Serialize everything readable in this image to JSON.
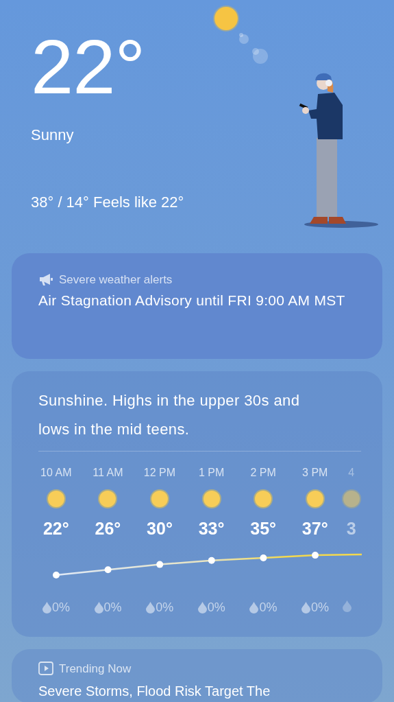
{
  "current": {
    "temperature": "22°",
    "condition": "Sunny",
    "range": "38° / 14° Feels like 22°"
  },
  "alert": {
    "header": "Severe weather alerts",
    "text": "Air Stagnation Advisory until FRI 9:00 AM MST"
  },
  "forecast": {
    "summary": "Sunshine. Highs in the upper 30s and lows in the mid teens.",
    "hours": [
      {
        "time": "10 AM",
        "temp": "22°",
        "precip": "0%"
      },
      {
        "time": "11 AM",
        "temp": "26°",
        "precip": "0%"
      },
      {
        "time": "12 PM",
        "temp": "30°",
        "precip": "0%"
      },
      {
        "time": "1 PM",
        "temp": "33°",
        "precip": "0%"
      },
      {
        "time": "2 PM",
        "temp": "35°",
        "precip": "0%"
      },
      {
        "time": "3 PM",
        "temp": "37°",
        "precip": "0%"
      },
      {
        "time": "4",
        "temp": "3"
      }
    ]
  },
  "trending": {
    "header": "Trending Now",
    "headline": "Severe Storms, Flood Risk Target The"
  }
}
